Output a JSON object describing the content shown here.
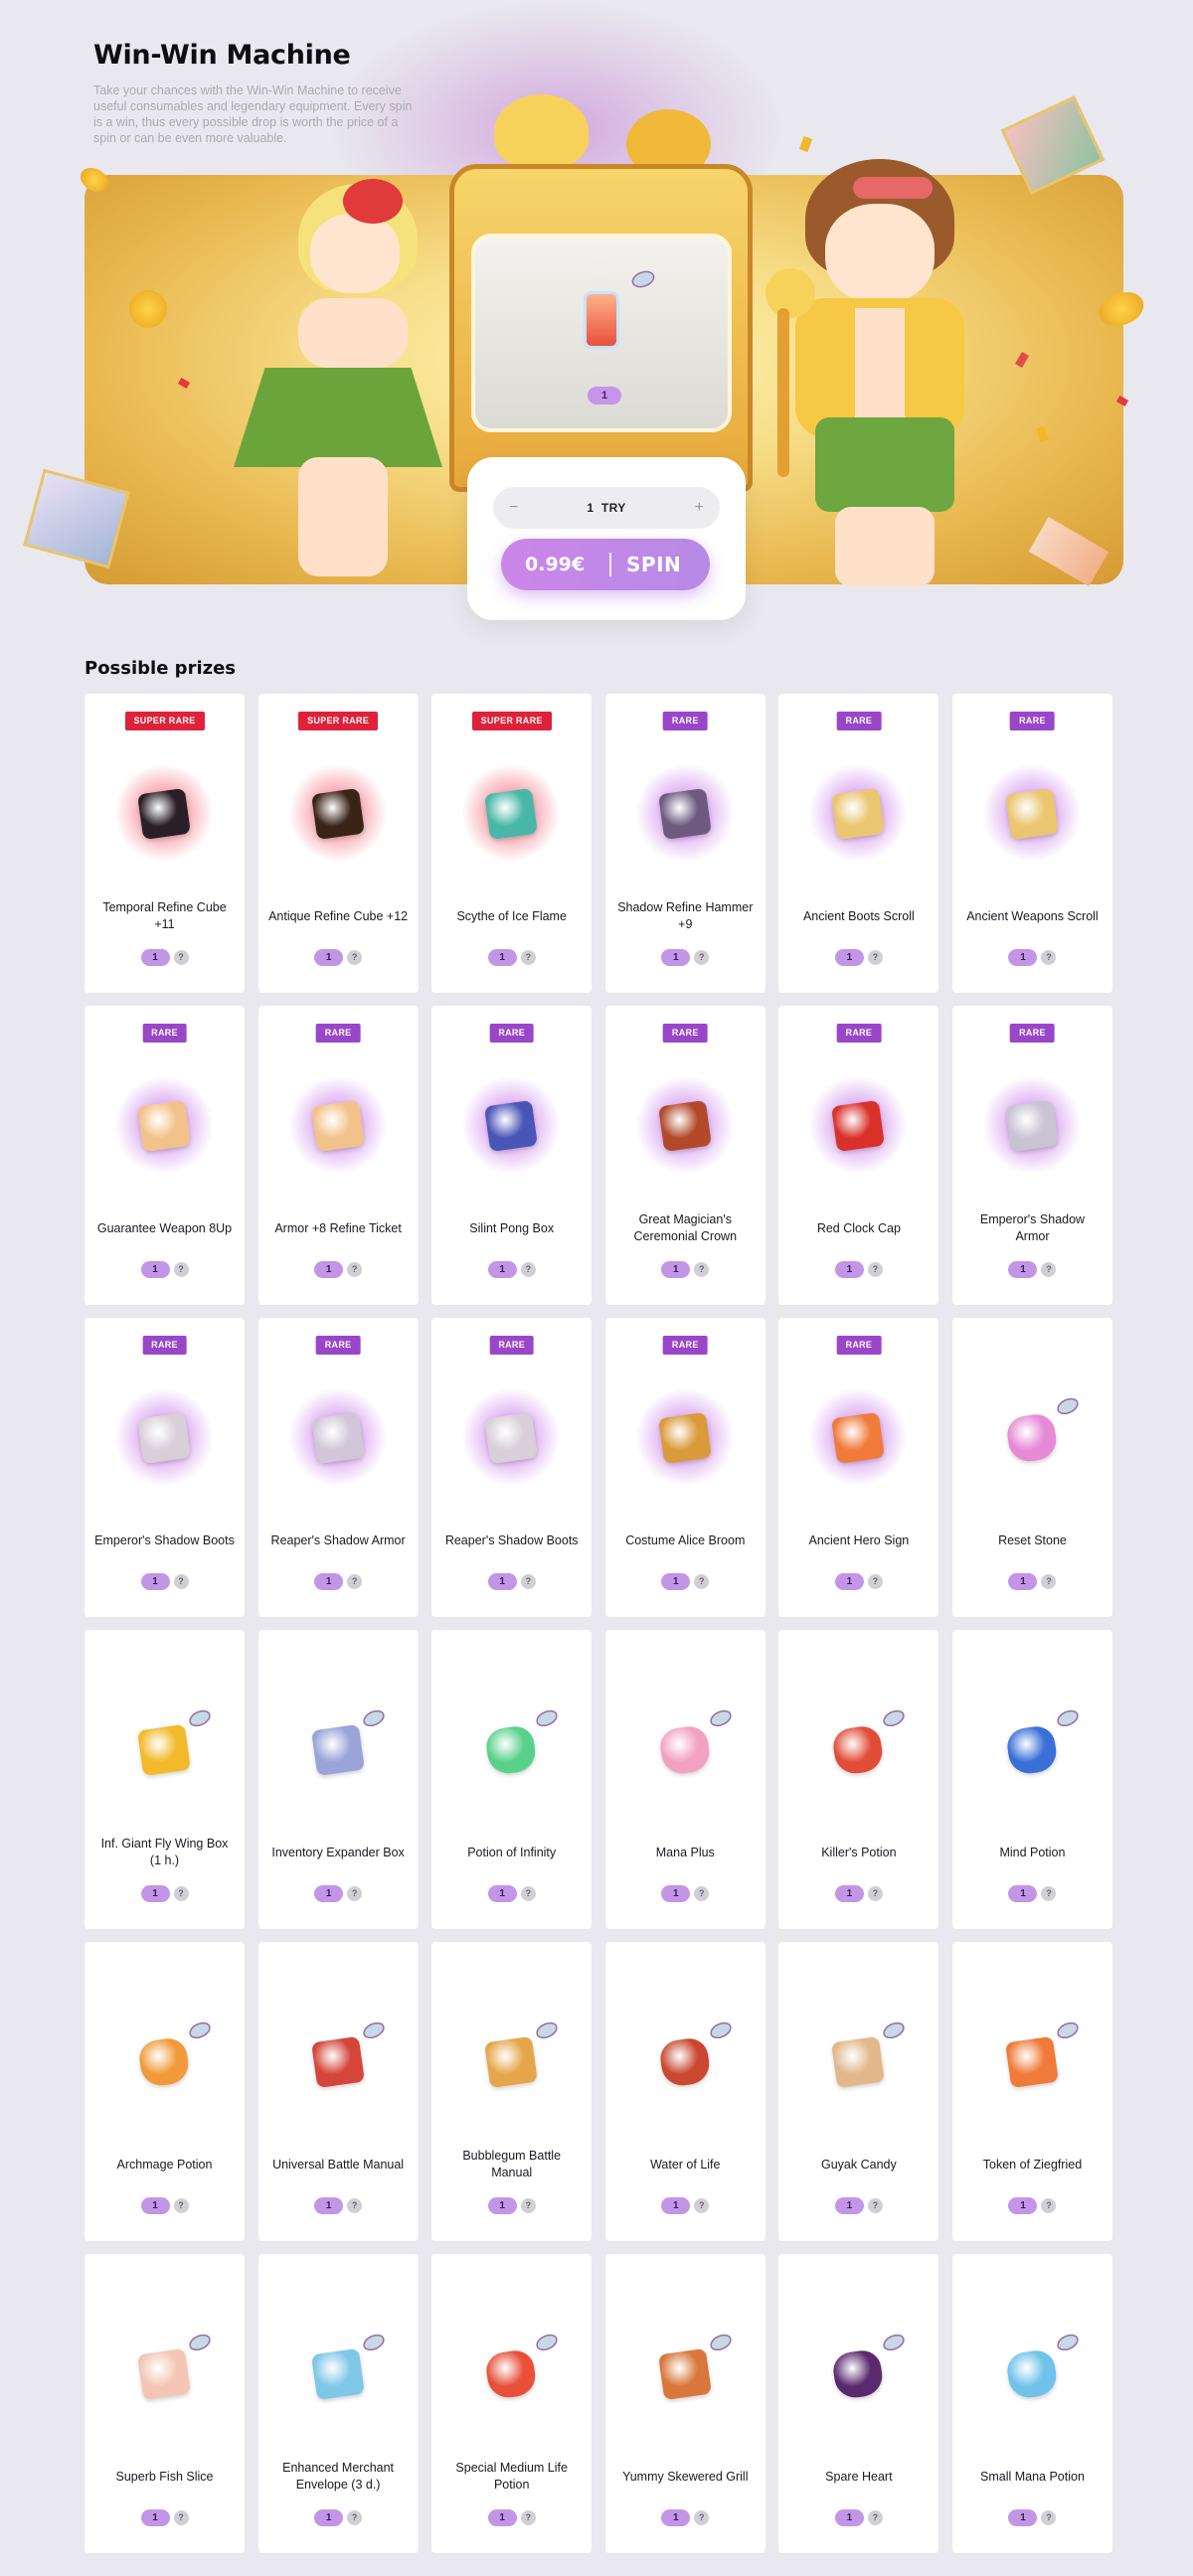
{
  "page": {
    "title": "Win-Win Machine",
    "description": "Take your chances with the Win-Win Machine to receive useful consumables and legendary equipment. Every spin is a win, thus every possible drop is worth the price of a spin or can be even more valuable."
  },
  "machine": {
    "screen_count": "1",
    "tries_value": "1",
    "tries_unit": "TRY",
    "tries_minus": "−",
    "tries_plus": "+",
    "spin_price": "0.99€",
    "spin_label": "SPIN"
  },
  "prizes": {
    "title": "Possible prizes",
    "help_label": "?",
    "items": [
      {
        "name": "Temporal Refine Cube +11",
        "rarity": "SUPER RARE",
        "tier": "super",
        "qty": "1",
        "icon": "black-cube-icon",
        "color": "#2a1f26"
      },
      {
        "name": "Antique Refine Cube +12",
        "rarity": "SUPER RARE",
        "tier": "super",
        "qty": "1",
        "icon": "antique-cube-icon",
        "color": "#3a2418"
      },
      {
        "name": "Scythe of Ice Flame",
        "rarity": "SUPER RARE",
        "tier": "super",
        "qty": "1",
        "icon": "scythe-icon",
        "color": "#49b7a8"
      },
      {
        "name": "Shadow Refine Hammer +9",
        "rarity": "RARE",
        "tier": "rare",
        "qty": "1",
        "icon": "hammer-icon",
        "color": "#6d5a7e"
      },
      {
        "name": "Ancient Boots Scroll",
        "rarity": "RARE",
        "tier": "rare",
        "qty": "1",
        "icon": "scroll-icon",
        "color": "#e9c66f"
      },
      {
        "name": "Ancient Weapons Scroll",
        "rarity": "RARE",
        "tier": "rare",
        "qty": "1",
        "icon": "scroll-icon",
        "color": "#e9c66f"
      },
      {
        "name": "Guarantee Weapon 8Up",
        "rarity": "RARE",
        "tier": "rare",
        "qty": "1",
        "icon": "ticket-icon",
        "color": "#f2c28a"
      },
      {
        "name": "Armor +8 Refine Ticket",
        "rarity": "RARE",
        "tier": "rare",
        "qty": "1",
        "icon": "ticket-icon",
        "color": "#f2c28a"
      },
      {
        "name": "Silint Pong Box",
        "rarity": "RARE",
        "tier": "rare",
        "qty": "1",
        "icon": "blue-box-icon",
        "color": "#4a55b8"
      },
      {
        "name": "Great Magician's Ceremonial Crown",
        "rarity": "RARE",
        "tier": "rare",
        "qty": "1",
        "icon": "crown-icon",
        "color": "#b24a2a"
      },
      {
        "name": "Red Clock Cap",
        "rarity": "RARE",
        "tier": "rare",
        "qty": "1",
        "icon": "cap-icon",
        "color": "#d9302a"
      },
      {
        "name": "Emperor's Shadow Armor",
        "rarity": "RARE",
        "tier": "rare",
        "qty": "1",
        "icon": "armor-icon",
        "color": "#c9c3d4"
      },
      {
        "name": "Emperor's Shadow Boots",
        "rarity": "RARE",
        "tier": "rare",
        "qty": "1",
        "icon": "boots-icon",
        "color": "#d8cfd8"
      },
      {
        "name": "Reaper's Shadow Armor",
        "rarity": "RARE",
        "tier": "rare",
        "qty": "1",
        "icon": "armor-icon",
        "color": "#d1c7d9"
      },
      {
        "name": "Reaper's Shadow Boots",
        "rarity": "RARE",
        "tier": "rare",
        "qty": "1",
        "icon": "boots-icon",
        "color": "#d8cfd8"
      },
      {
        "name": "Costume Alice Broom",
        "rarity": "RARE",
        "tier": "rare",
        "qty": "1",
        "icon": "broom-icon",
        "color": "#d99a3a"
      },
      {
        "name": "Ancient Hero Sign",
        "rarity": "RARE",
        "tier": "rare",
        "qty": "1",
        "icon": "star-sign-icon",
        "color": "#ef7a3a"
      },
      {
        "name": "Reset Stone",
        "rarity": "",
        "tier": "none",
        "qty": "1",
        "icon": "stone-icon",
        "color": "#e78ad6"
      },
      {
        "name": "Inf. Giant Fly Wing Box (1 h.)",
        "rarity": "",
        "tier": "none",
        "qty": "1",
        "icon": "gift-box-icon",
        "color": "#f2b92a"
      },
      {
        "name": "Inventory Expander Box",
        "rarity": "",
        "tier": "none",
        "qty": "1",
        "icon": "expander-box-icon",
        "color": "#9aa4d8"
      },
      {
        "name": "Potion of Infinity",
        "rarity": "",
        "tier": "none",
        "qty": "1",
        "icon": "potion-icon",
        "color": "#5ad18a"
      },
      {
        "name": "Mana Plus",
        "rarity": "",
        "tier": "none",
        "qty": "1",
        "icon": "potion-icon",
        "color": "#f1a2c0"
      },
      {
        "name": "Killer's Potion",
        "rarity": "",
        "tier": "none",
        "qty": "1",
        "icon": "potion-icon",
        "color": "#e24d3a"
      },
      {
        "name": "Mind Potion",
        "rarity": "",
        "tier": "none",
        "qty": "1",
        "icon": "potion-icon",
        "color": "#3a6fd8"
      },
      {
        "name": "Archmage Potion",
        "rarity": "",
        "tier": "none",
        "qty": "1",
        "icon": "potion-icon",
        "color": "#f29a3a"
      },
      {
        "name": "Universal Battle Manual",
        "rarity": "",
        "tier": "none",
        "qty": "1",
        "icon": "book-icon",
        "color": "#d6453a"
      },
      {
        "name": "Bubblegum Battle Manual",
        "rarity": "",
        "tier": "none",
        "qty": "1",
        "icon": "book-icon",
        "color": "#e5a64a"
      },
      {
        "name": "Water of Life",
        "rarity": "",
        "tier": "none",
        "qty": "1",
        "icon": "potion-icon",
        "color": "#c9482f"
      },
      {
        "name": "Guyak Candy",
        "rarity": "",
        "tier": "none",
        "qty": "1",
        "icon": "candy-icon",
        "color": "#e2b88a"
      },
      {
        "name": "Token of Ziegfried",
        "rarity": "",
        "tier": "none",
        "qty": "1",
        "icon": "feather-token-icon",
        "color": "#ef7a3a"
      },
      {
        "name": "Superb Fish Slice",
        "rarity": "",
        "tier": "none",
        "qty": "1",
        "icon": "fish-slice-icon",
        "color": "#f3c6b4"
      },
      {
        "name": "Enhanced Merchant Envelope (3 d.)",
        "rarity": "",
        "tier": "none",
        "qty": "1",
        "icon": "envelope-icon",
        "color": "#7ec7e6"
      },
      {
        "name": "Special Medium Life Potion",
        "rarity": "",
        "tier": "none",
        "qty": "1",
        "icon": "potion-jar-icon",
        "color": "#e8503a"
      },
      {
        "name": "Yummy Skewered Grill",
        "rarity": "",
        "tier": "none",
        "qty": "1",
        "icon": "skewer-icon",
        "color": "#d9763a"
      },
      {
        "name": "Spare Heart",
        "rarity": "",
        "tier": "none",
        "qty": "1",
        "icon": "heart-icon",
        "color": "#5a2a6e"
      },
      {
        "name": "Small Mana Potion",
        "rarity": "",
        "tier": "none",
        "qty": "1",
        "icon": "potion-jar-icon",
        "color": "#6fc2ea"
      }
    ]
  }
}
